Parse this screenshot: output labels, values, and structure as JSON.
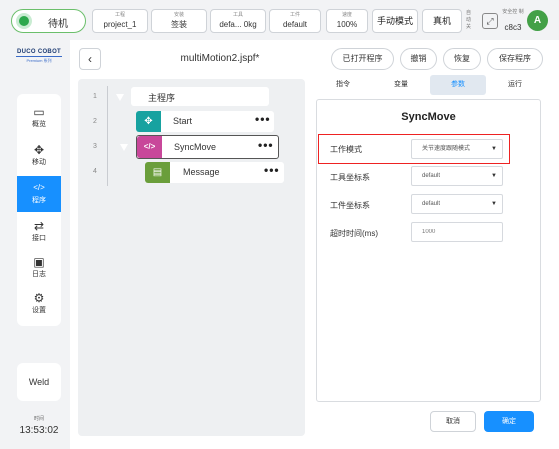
{
  "topbar": {
    "status": "待机",
    "project_label": "工程",
    "project_value": "project_1",
    "install_label": "安装",
    "install_value": "签装",
    "tool_label": "工具",
    "tool_value": "defa... 0kg",
    "workpiece_label": "工件",
    "workpiece_value": "default",
    "speed_label": "速度",
    "speed_value": "100%",
    "mode_button": "手动模式",
    "real_button": "真机",
    "state_small": "自 动 关",
    "safety_label": "安全控 制",
    "safety_value": "c8c3",
    "avatar": "A"
  },
  "sidebar": {
    "logo_main": "DUCO COBOT",
    "logo_sub": "Premium 系列",
    "items": [
      {
        "label": "概览",
        "icon": "monitor-icon"
      },
      {
        "label": "移动",
        "icon": "move-icon"
      },
      {
        "label": "程序",
        "icon": "code-icon"
      },
      {
        "label": "接口",
        "icon": "interface-icon"
      },
      {
        "label": "日志",
        "icon": "calendar-icon"
      },
      {
        "label": "设置",
        "icon": "gear-icon"
      }
    ],
    "weld": "Weld",
    "time_label": "时间",
    "time_value": "13:53:02"
  },
  "header": {
    "file_title": "multiMotion2.jspf*",
    "buttons": [
      "已打开程序",
      "撤销",
      "恢复",
      "保存程序"
    ]
  },
  "tree": {
    "rows": [
      {
        "num": "1",
        "label": "主程序"
      },
      {
        "num": "2",
        "label": "Start",
        "icon": "✥",
        "color": "#17a2a0"
      },
      {
        "num": "3",
        "label": "SyncMove",
        "icon": "</>",
        "color": "#c8479a"
      },
      {
        "num": "4",
        "label": "Message",
        "icon": "▤",
        "color": "#6a9e3b"
      }
    ],
    "menu_dots": "•••"
  },
  "tabs": [
    "指令",
    "变量",
    "参数",
    "运行"
  ],
  "props": {
    "title": "SyncMove",
    "work_mode_label": "工作模式",
    "work_mode_value": "关节速度跟随模式",
    "tool_frame_label": "工具坐标系",
    "tool_frame_value": "default",
    "work_frame_label": "工件坐标系",
    "work_frame_value": "default",
    "timeout_label": "超时时间(ms)",
    "timeout_placeholder": "1000"
  },
  "footer": {
    "cancel": "取消",
    "confirm": "确定"
  },
  "colors": {
    "accent": "#1790ff",
    "highlight": "#ee2222",
    "status_green": "#2ca84c"
  }
}
